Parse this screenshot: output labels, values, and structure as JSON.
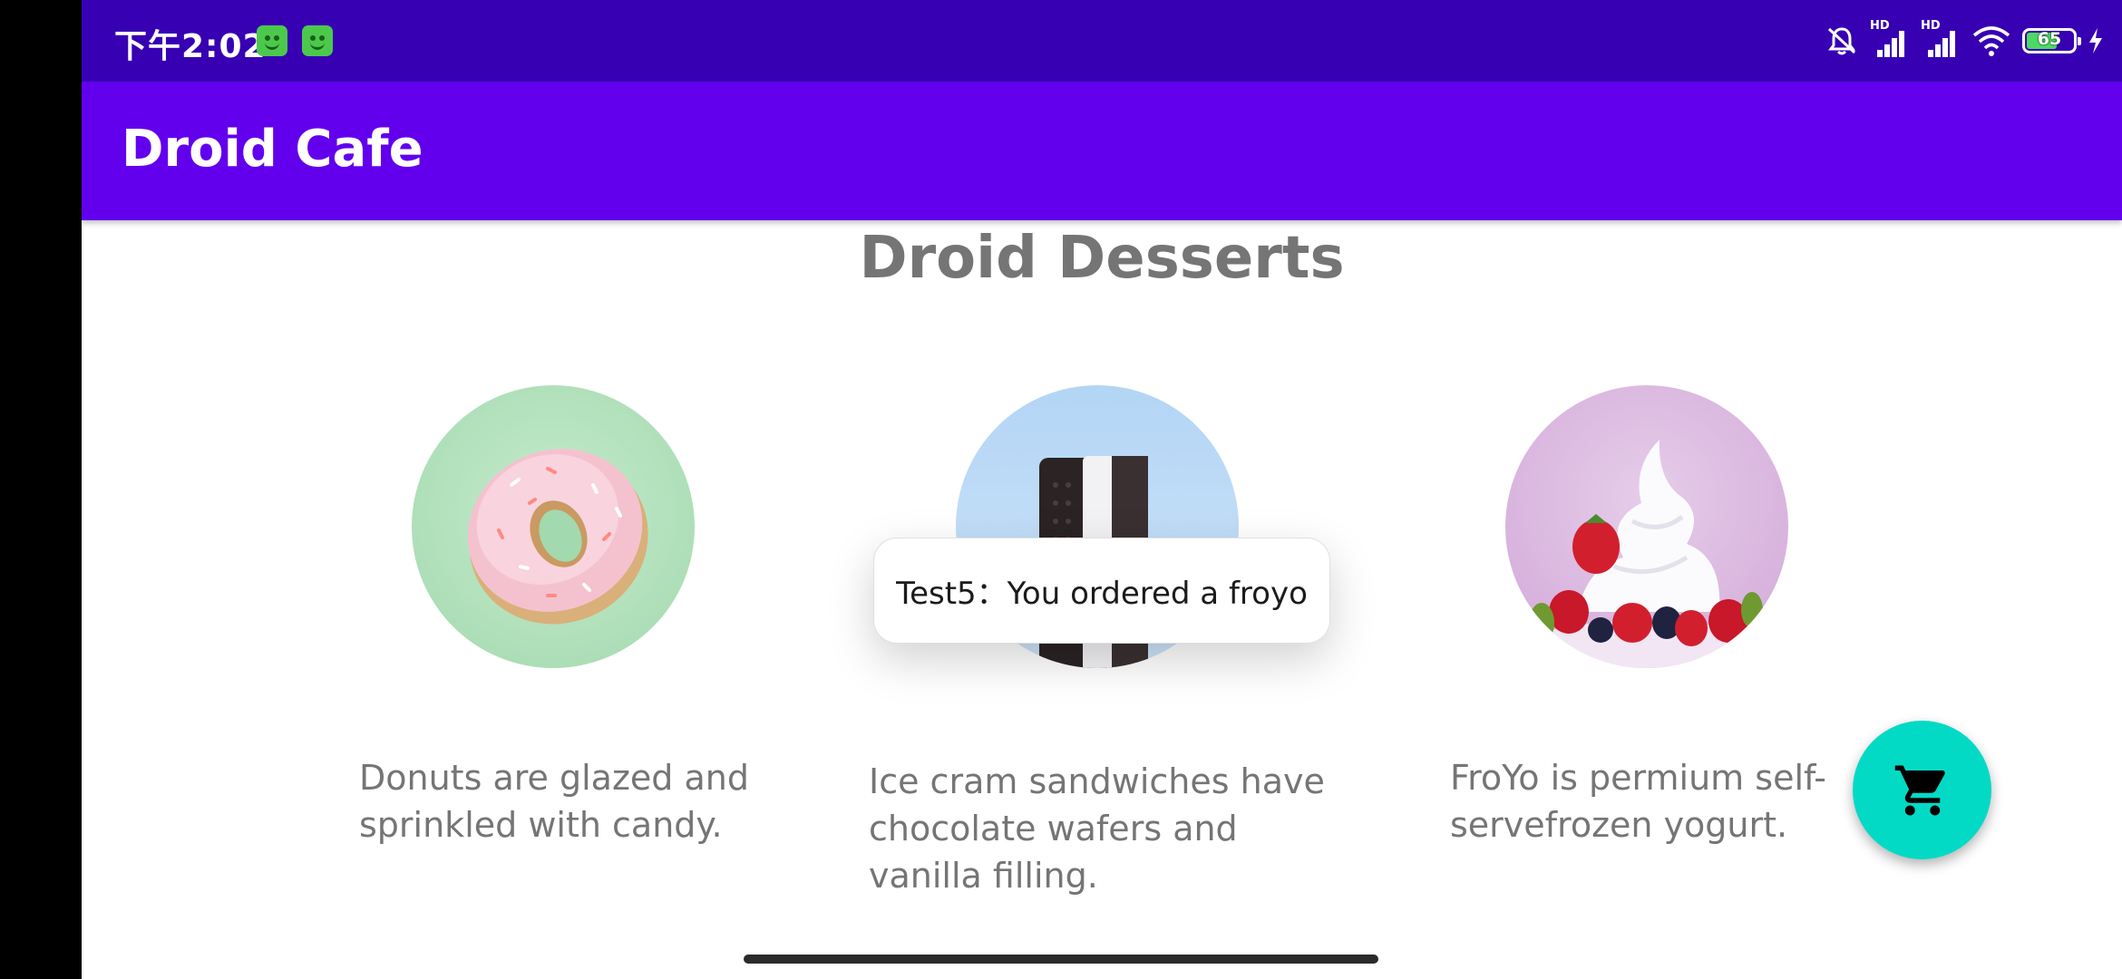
{
  "status_bar": {
    "time": "下午2:02",
    "battery_level": "65",
    "network_label_1": "HD",
    "network_label_2": "HD",
    "icons": [
      "app-notification-icon",
      "app-notification-icon",
      "silent-icon",
      "signal-icon",
      "signal-icon",
      "wifi-icon",
      "battery-icon",
      "charging-icon"
    ]
  },
  "app_bar": {
    "title": "Droid Cafe"
  },
  "main": {
    "heading": "Droid Desserts",
    "desserts": [
      {
        "image": "donut-image",
        "description": "Donuts are glazed and sprinkled with candy."
      },
      {
        "image": "ice-cream-sandwich-image",
        "description": "Ice cram sandwiches have chocolate wafers and vanilla filling."
      },
      {
        "image": "froyo-image",
        "description": "FroYo is permium self-servefrozen yogurt."
      }
    ]
  },
  "toast": {
    "message": "Test5：You ordered a froyo"
  },
  "fab": {
    "icon": "shopping-cart-icon"
  },
  "colors": {
    "status_bar": "#3700b3",
    "app_bar": "#6200ee",
    "fab": "#03dac5",
    "text_gray": "#757575"
  }
}
